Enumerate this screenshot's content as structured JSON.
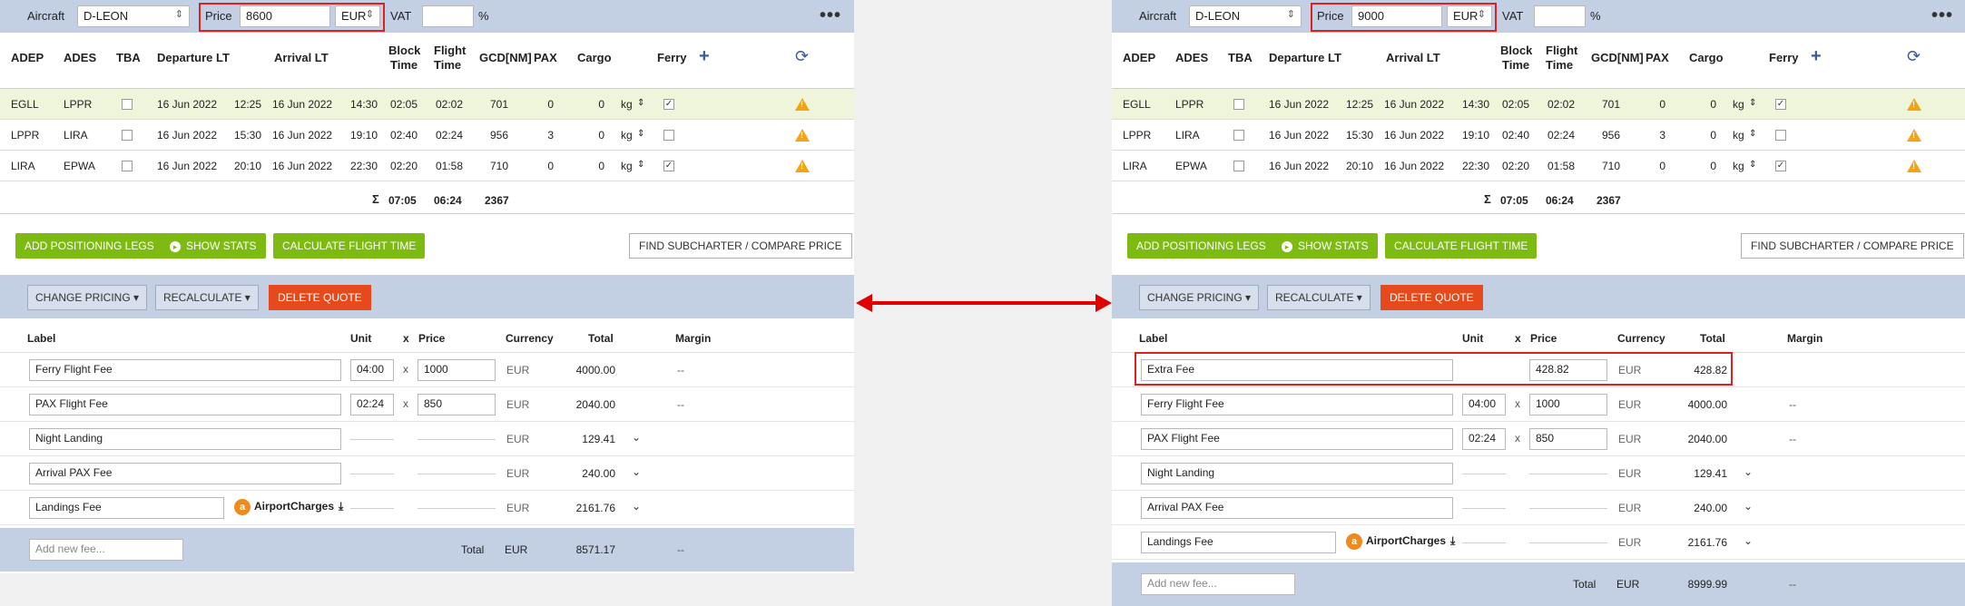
{
  "common": {
    "aircraft_label": "Aircraft",
    "aircraft_value": "D-LEON",
    "price_label": "Price",
    "currency_value": "EUR",
    "vat_label": "VAT",
    "percent": "%",
    "more": "•••",
    "headers": {
      "adep": "ADEP",
      "ades": "ADES",
      "tba": "TBA",
      "dep": "Departure LT",
      "arr": "Arrival LT",
      "block1": "Block",
      "block2": "Time",
      "flight1": "Flight",
      "flight2": "Time",
      "gcd": "GCD[NM]",
      "pax": "PAX",
      "cargo": "Cargo",
      "ferry": "Ferry"
    },
    "legs": [
      {
        "adep": "EGLL",
        "ades": "LPPR",
        "dep_date": "16 Jun 2022",
        "dep_time": "12:25",
        "arr_date": "16 Jun 2022",
        "arr_time": "14:30",
        "block": "02:05",
        "flight": "02:02",
        "gcd": "701",
        "pax": "0",
        "cargo": "0",
        "unit": "kg",
        "ferry": "✓"
      },
      {
        "adep": "LPPR",
        "ades": "LIRA",
        "dep_date": "16 Jun 2022",
        "dep_time": "15:30",
        "arr_date": "16 Jun 2022",
        "arr_time": "19:10",
        "block": "02:40",
        "flight": "02:24",
        "gcd": "956",
        "pax": "3",
        "cargo": "0",
        "unit": "kg",
        "ferry": ""
      },
      {
        "adep": "LIRA",
        "ades": "EPWA",
        "dep_date": "16 Jun 2022",
        "dep_time": "20:10",
        "arr_date": "16 Jun 2022",
        "arr_time": "22:30",
        "block": "02:20",
        "flight": "01:58",
        "gcd": "710",
        "pax": "0",
        "cargo": "0",
        "unit": "kg",
        "ferry": "✓"
      }
    ],
    "sum_symbol": "Σ",
    "sum_block": "07:05",
    "sum_flight": "06:24",
    "sum_gcd": "2367",
    "btn_positioning": "ADD POSITIONING LEGS",
    "btn_stats": "SHOW STATS",
    "btn_calc": "CALCULATE FLIGHT TIME",
    "btn_subcharter": "FIND SUBCHARTER / COMPARE PRICE",
    "btn_change_pricing": "CHANGE PRICING ▾",
    "btn_recalculate": "RECALCULATE ▾",
    "btn_delete": "DELETE QUOTE",
    "fee_headers": {
      "label": "Label",
      "unit": "Unit",
      "x": "x",
      "price": "Price",
      "currency": "Currency",
      "total": "Total",
      "margin": "Margin"
    },
    "x": "x",
    "eur": "EUR",
    "margin_dash": "--",
    "airport_charges": "AirportCharges",
    "add_fee_placeholder": "Add new fee...",
    "total_label": "Total"
  },
  "left": {
    "price_value": "8600",
    "fees": [
      {
        "label": "Ferry Flight Fee",
        "unit": "04:00",
        "price": "1000",
        "total": "4000.00",
        "kind": "margin"
      },
      {
        "label": "PAX Flight Fee",
        "unit": "02:24",
        "price": "850",
        "total": "2040.00",
        "kind": "margin"
      },
      {
        "label": "Night Landing",
        "unit": "",
        "price": "",
        "total": "129.41",
        "kind": "chev"
      },
      {
        "label": "Arrival PAX Fee",
        "unit": "",
        "price": "",
        "total": "240.00",
        "kind": "chev"
      },
      {
        "label": "Landings Fee",
        "unit": "",
        "price": "",
        "total": "2161.76",
        "kind": "airport"
      }
    ],
    "total_value": "8571.17"
  },
  "right": {
    "price_value": "9000",
    "fees": [
      {
        "label": "Extra Fee",
        "unit": "",
        "price": "428.82",
        "total": "428.82",
        "kind": "extra"
      },
      {
        "label": "Ferry Flight Fee",
        "unit": "04:00",
        "price": "1000",
        "total": "4000.00",
        "kind": "margin"
      },
      {
        "label": "PAX Flight Fee",
        "unit": "02:24",
        "price": "850",
        "total": "2040.00",
        "kind": "margin"
      },
      {
        "label": "Night Landing",
        "unit": "",
        "price": "",
        "total": "129.41",
        "kind": "chev"
      },
      {
        "label": "Arrival PAX Fee",
        "unit": "",
        "price": "",
        "total": "240.00",
        "kind": "chev"
      },
      {
        "label": "Landings Fee",
        "unit": "",
        "price": "",
        "total": "2161.76",
        "kind": "airport"
      }
    ],
    "total_value": "8999.99"
  },
  "colors": {
    "accent_green": "#7dbb12",
    "delete_red": "#e6491c",
    "highlight_red": "#e02020",
    "bar_blue": "#c3d0e3",
    "warning": "#f5a214"
  },
  "icons": [
    "warning-icon",
    "refresh-icon",
    "plus-icon",
    "more-icon",
    "chevron-down-icon",
    "download-icon",
    "airport-charges-icon",
    "checkbox-icon",
    "double-arrow-icon"
  ]
}
